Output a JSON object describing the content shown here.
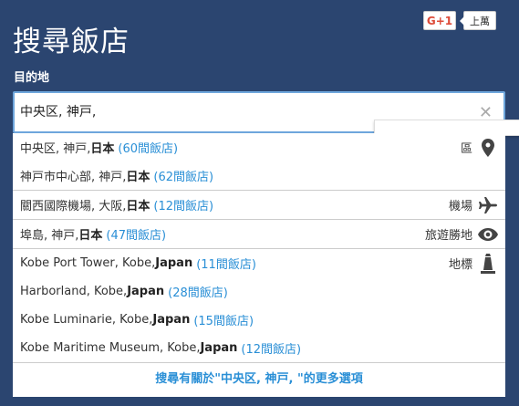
{
  "header": {
    "title": "搜尋飯店",
    "gplus": {
      "label": "G+1",
      "count": "上萬"
    }
  },
  "search": {
    "label": "目的地",
    "value": "中央区, 神戸,",
    "placeholder": ""
  },
  "suggestions": [
    {
      "type_label": "區",
      "icon": "map-pin-icon",
      "items": [
        {
          "name": "中央区, 神戸, ",
          "country": "日本",
          "count": "(60間飯店)"
        },
        {
          "name": "神戸市中心部, 神戸, ",
          "country": "日本",
          "count": "(62間飯店)"
        }
      ]
    },
    {
      "type_label": "機場",
      "icon": "airplane-icon",
      "items": [
        {
          "name": "關西國際機場, 大阪, ",
          "country": "日本",
          "count": "(12間飯店)"
        }
      ]
    },
    {
      "type_label": "旅遊勝地",
      "icon": "eye-icon",
      "items": [
        {
          "name": "埠島, 神戸, ",
          "country": "日本",
          "count": "(47間飯店)"
        }
      ]
    },
    {
      "type_label": "地標",
      "icon": "landmark-icon",
      "items": [
        {
          "name": "Kobe Port Tower, Kobe, ",
          "country": "Japan",
          "count": "(11間飯店)"
        },
        {
          "name": "Harborland, Kobe, ",
          "country": "Japan",
          "count": "(28間飯店)"
        },
        {
          "name": "Kobe Luminarie, Kobe, ",
          "country": "Japan",
          "count": "(15間飯店)"
        },
        {
          "name": "Kobe Maritime Museum, Kobe, ",
          "country": "Japan",
          "count": "(12間飯店)"
        }
      ]
    }
  ],
  "more_link": "搜尋有關於\"中央区, 神戸, \"的更多選項",
  "colors": {
    "background": "#2b4570",
    "link": "#2a8fd6",
    "focus_border": "#6ea6dc"
  }
}
